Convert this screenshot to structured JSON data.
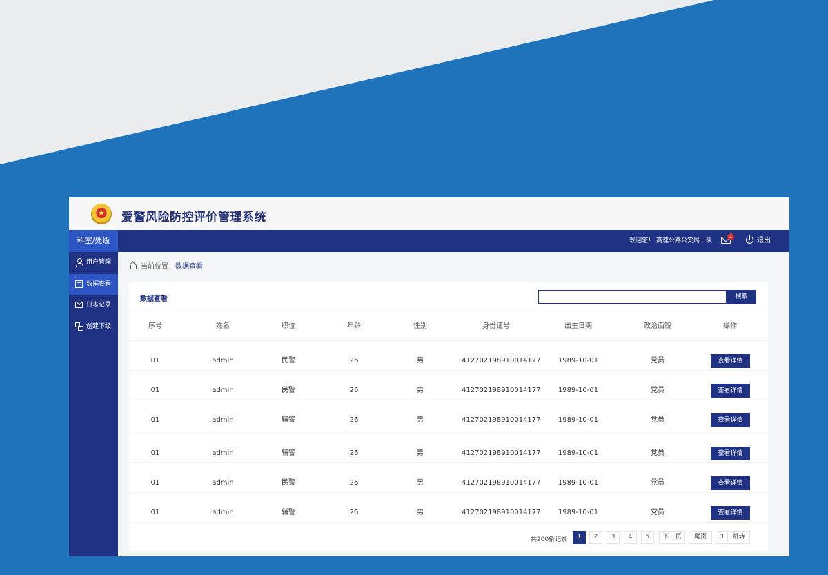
{
  "app": {
    "logo_glyph": "★",
    "title": "爱警风险防控评价管理系统"
  },
  "topbar": {
    "dept": "科室/处级",
    "welcome": "欢迎您！ 高速公路公安局一队",
    "mail_badge": "1",
    "logout": "退出"
  },
  "sidebar": {
    "items": [
      {
        "label": "用户管理",
        "icon": "user-icon"
      },
      {
        "label": "数据查看",
        "icon": "document-icon"
      },
      {
        "label": "日志记录",
        "icon": "mail-icon"
      },
      {
        "label": "创建下级",
        "icon": "org-icon"
      }
    ],
    "active": 1
  },
  "breadcrumb": {
    "prefix": "当前位置：",
    "current": "数据查看"
  },
  "panel": {
    "title": "数据查看",
    "search_value": "",
    "search_button": "搜索"
  },
  "table": {
    "headers": [
      "序号",
      "姓名",
      "职位",
      "年龄",
      "性别",
      "身份证号",
      "出生日期",
      "政治面貌",
      "操作"
    ],
    "action_label": "查看详情",
    "rows": [
      [
        "01",
        "admin",
        "民警",
        "26",
        "男",
        "412702198910014177",
        "1989-10-01",
        "党员"
      ],
      [
        "01",
        "admin",
        "民警",
        "26",
        "男",
        "412702198910014177",
        "1989-10-01",
        "党员"
      ],
      [
        "01",
        "admin",
        "辅警",
        "26",
        "男",
        "412702198910014177",
        "1989-10-01",
        "党员"
      ],
      [
        "01",
        "admin",
        "辅警",
        "26",
        "男",
        "412702198910014177",
        "1989-10-01",
        "党员"
      ],
      [
        "01",
        "admin",
        "民警",
        "26",
        "男",
        "412702198910014177",
        "1989-10-01",
        "党员"
      ],
      [
        "01",
        "admin",
        "辅警",
        "26",
        "男",
        "412702198910014177",
        "1989-10-01",
        "党员"
      ]
    ]
  },
  "pagination": {
    "total": "共200条记录",
    "pages": [
      "1",
      "2",
      "3",
      "4",
      "5"
    ],
    "current": "1",
    "next": "下一页",
    "last": "尾页",
    "jump_value": "3",
    "jump": "跳转"
  },
  "colors": {
    "brand_dark": "#1f3283",
    "brand_active": "#2d55c4",
    "background_blue": "#1e73bb",
    "badge_red": "#d32f2f"
  }
}
